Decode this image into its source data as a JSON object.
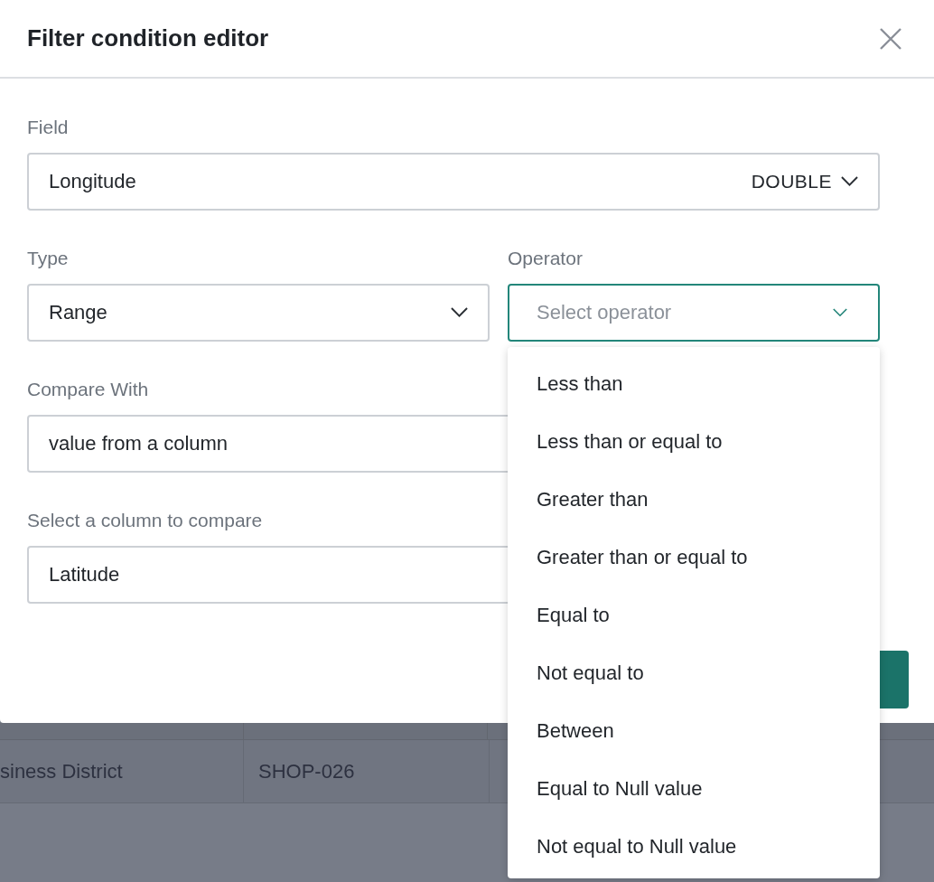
{
  "dialog": {
    "title": "Filter condition editor"
  },
  "field": {
    "label": "Field",
    "value": "Longitude",
    "data_type": "DOUBLE"
  },
  "type": {
    "label": "Type",
    "value": "Range"
  },
  "operator": {
    "label": "Operator",
    "placeholder": "Select operator",
    "focused": true,
    "expanded": true,
    "options": [
      {
        "label": "Less than",
        "selected": false
      },
      {
        "label": "Less than or equal to",
        "selected": false
      },
      {
        "label": "Greater than",
        "selected": false
      },
      {
        "label": "Greater than or equal to",
        "selected": false
      },
      {
        "label": "Equal to",
        "selected": false
      },
      {
        "label": "Not equal to",
        "selected": false
      },
      {
        "label": "Between",
        "selected": false
      },
      {
        "label": "Equal to Null value",
        "selected": false
      },
      {
        "label": "Not equal to Null value",
        "selected": false
      }
    ]
  },
  "compare_with": {
    "label": "Compare With",
    "value": "value from a column"
  },
  "compare_column": {
    "label": "Select a column to compare",
    "value": "Latitude"
  },
  "background_table": {
    "rows": [
      {
        "cells": [
          "siness District",
          "SHOP-026"
        ]
      }
    ]
  }
}
